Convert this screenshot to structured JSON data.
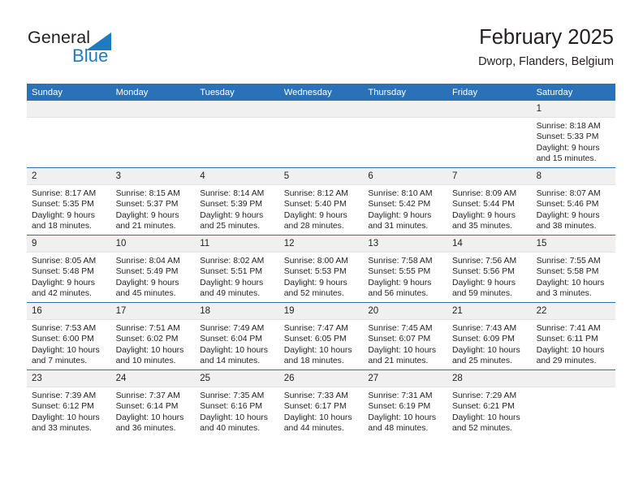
{
  "brand": {
    "name_part1": "General",
    "name_part2": "Blue",
    "triangle_color": "#1f7bc1",
    "text_color": "#231f20"
  },
  "header": {
    "title": "February 2025",
    "subtitle": "Dworp, Flanders, Belgium"
  },
  "theme": {
    "header_row_bg": "#2b71b8",
    "header_row_text": "#ffffff",
    "daynum_bg": "#f0f0f0",
    "row_divider": "#2b71b8",
    "body_text": "#231f20"
  },
  "weekday_headers": [
    "Sunday",
    "Monday",
    "Tuesday",
    "Wednesday",
    "Thursday",
    "Friday",
    "Saturday"
  ],
  "labels": {
    "sunrise_prefix": "Sunrise:",
    "sunset_prefix": "Sunset:",
    "daylight_prefix": "Daylight:"
  },
  "weeks": [
    [
      {
        "day": "",
        "empty": true
      },
      {
        "day": "",
        "empty": true
      },
      {
        "day": "",
        "empty": true
      },
      {
        "day": "",
        "empty": true
      },
      {
        "day": "",
        "empty": true
      },
      {
        "day": "",
        "empty": true
      },
      {
        "day": "1",
        "sunrise": "Sunrise: 8:18 AM",
        "sunset": "Sunset: 5:33 PM",
        "daylight_line1": "Daylight: 9 hours",
        "daylight_line2": "and 15 minutes."
      }
    ],
    [
      {
        "day": "2",
        "sunrise": "Sunrise: 8:17 AM",
        "sunset": "Sunset: 5:35 PM",
        "daylight_line1": "Daylight: 9 hours",
        "daylight_line2": "and 18 minutes."
      },
      {
        "day": "3",
        "sunrise": "Sunrise: 8:15 AM",
        "sunset": "Sunset: 5:37 PM",
        "daylight_line1": "Daylight: 9 hours",
        "daylight_line2": "and 21 minutes."
      },
      {
        "day": "4",
        "sunrise": "Sunrise: 8:14 AM",
        "sunset": "Sunset: 5:39 PM",
        "daylight_line1": "Daylight: 9 hours",
        "daylight_line2": "and 25 minutes."
      },
      {
        "day": "5",
        "sunrise": "Sunrise: 8:12 AM",
        "sunset": "Sunset: 5:40 PM",
        "daylight_line1": "Daylight: 9 hours",
        "daylight_line2": "and 28 minutes."
      },
      {
        "day": "6",
        "sunrise": "Sunrise: 8:10 AM",
        "sunset": "Sunset: 5:42 PM",
        "daylight_line1": "Daylight: 9 hours",
        "daylight_line2": "and 31 minutes."
      },
      {
        "day": "7",
        "sunrise": "Sunrise: 8:09 AM",
        "sunset": "Sunset: 5:44 PM",
        "daylight_line1": "Daylight: 9 hours",
        "daylight_line2": "and 35 minutes."
      },
      {
        "day": "8",
        "sunrise": "Sunrise: 8:07 AM",
        "sunset": "Sunset: 5:46 PM",
        "daylight_line1": "Daylight: 9 hours",
        "daylight_line2": "and 38 minutes."
      }
    ],
    [
      {
        "day": "9",
        "sunrise": "Sunrise: 8:05 AM",
        "sunset": "Sunset: 5:48 PM",
        "daylight_line1": "Daylight: 9 hours",
        "daylight_line2": "and 42 minutes."
      },
      {
        "day": "10",
        "sunrise": "Sunrise: 8:04 AM",
        "sunset": "Sunset: 5:49 PM",
        "daylight_line1": "Daylight: 9 hours",
        "daylight_line2": "and 45 minutes."
      },
      {
        "day": "11",
        "sunrise": "Sunrise: 8:02 AM",
        "sunset": "Sunset: 5:51 PM",
        "daylight_line1": "Daylight: 9 hours",
        "daylight_line2": "and 49 minutes."
      },
      {
        "day": "12",
        "sunrise": "Sunrise: 8:00 AM",
        "sunset": "Sunset: 5:53 PM",
        "daylight_line1": "Daylight: 9 hours",
        "daylight_line2": "and 52 minutes."
      },
      {
        "day": "13",
        "sunrise": "Sunrise: 7:58 AM",
        "sunset": "Sunset: 5:55 PM",
        "daylight_line1": "Daylight: 9 hours",
        "daylight_line2": "and 56 minutes."
      },
      {
        "day": "14",
        "sunrise": "Sunrise: 7:56 AM",
        "sunset": "Sunset: 5:56 PM",
        "daylight_line1": "Daylight: 9 hours",
        "daylight_line2": "and 59 minutes."
      },
      {
        "day": "15",
        "sunrise": "Sunrise: 7:55 AM",
        "sunset": "Sunset: 5:58 PM",
        "daylight_line1": "Daylight: 10 hours",
        "daylight_line2": "and 3 minutes."
      }
    ],
    [
      {
        "day": "16",
        "sunrise": "Sunrise: 7:53 AM",
        "sunset": "Sunset: 6:00 PM",
        "daylight_line1": "Daylight: 10 hours",
        "daylight_line2": "and 7 minutes."
      },
      {
        "day": "17",
        "sunrise": "Sunrise: 7:51 AM",
        "sunset": "Sunset: 6:02 PM",
        "daylight_line1": "Daylight: 10 hours",
        "daylight_line2": "and 10 minutes."
      },
      {
        "day": "18",
        "sunrise": "Sunrise: 7:49 AM",
        "sunset": "Sunset: 6:04 PM",
        "daylight_line1": "Daylight: 10 hours",
        "daylight_line2": "and 14 minutes."
      },
      {
        "day": "19",
        "sunrise": "Sunrise: 7:47 AM",
        "sunset": "Sunset: 6:05 PM",
        "daylight_line1": "Daylight: 10 hours",
        "daylight_line2": "and 18 minutes."
      },
      {
        "day": "20",
        "sunrise": "Sunrise: 7:45 AM",
        "sunset": "Sunset: 6:07 PM",
        "daylight_line1": "Daylight: 10 hours",
        "daylight_line2": "and 21 minutes."
      },
      {
        "day": "21",
        "sunrise": "Sunrise: 7:43 AM",
        "sunset": "Sunset: 6:09 PM",
        "daylight_line1": "Daylight: 10 hours",
        "daylight_line2": "and 25 minutes."
      },
      {
        "day": "22",
        "sunrise": "Sunrise: 7:41 AM",
        "sunset": "Sunset: 6:11 PM",
        "daylight_line1": "Daylight: 10 hours",
        "daylight_line2": "and 29 minutes."
      }
    ],
    [
      {
        "day": "23",
        "sunrise": "Sunrise: 7:39 AM",
        "sunset": "Sunset: 6:12 PM",
        "daylight_line1": "Daylight: 10 hours",
        "daylight_line2": "and 33 minutes."
      },
      {
        "day": "24",
        "sunrise": "Sunrise: 7:37 AM",
        "sunset": "Sunset: 6:14 PM",
        "daylight_line1": "Daylight: 10 hours",
        "daylight_line2": "and 36 minutes."
      },
      {
        "day": "25",
        "sunrise": "Sunrise: 7:35 AM",
        "sunset": "Sunset: 6:16 PM",
        "daylight_line1": "Daylight: 10 hours",
        "daylight_line2": "and 40 minutes."
      },
      {
        "day": "26",
        "sunrise": "Sunrise: 7:33 AM",
        "sunset": "Sunset: 6:17 PM",
        "daylight_line1": "Daylight: 10 hours",
        "daylight_line2": "and 44 minutes."
      },
      {
        "day": "27",
        "sunrise": "Sunrise: 7:31 AM",
        "sunset": "Sunset: 6:19 PM",
        "daylight_line1": "Daylight: 10 hours",
        "daylight_line2": "and 48 minutes."
      },
      {
        "day": "28",
        "sunrise": "Sunrise: 7:29 AM",
        "sunset": "Sunset: 6:21 PM",
        "daylight_line1": "Daylight: 10 hours",
        "daylight_line2": "and 52 minutes."
      },
      {
        "day": "",
        "empty": true
      }
    ]
  ]
}
